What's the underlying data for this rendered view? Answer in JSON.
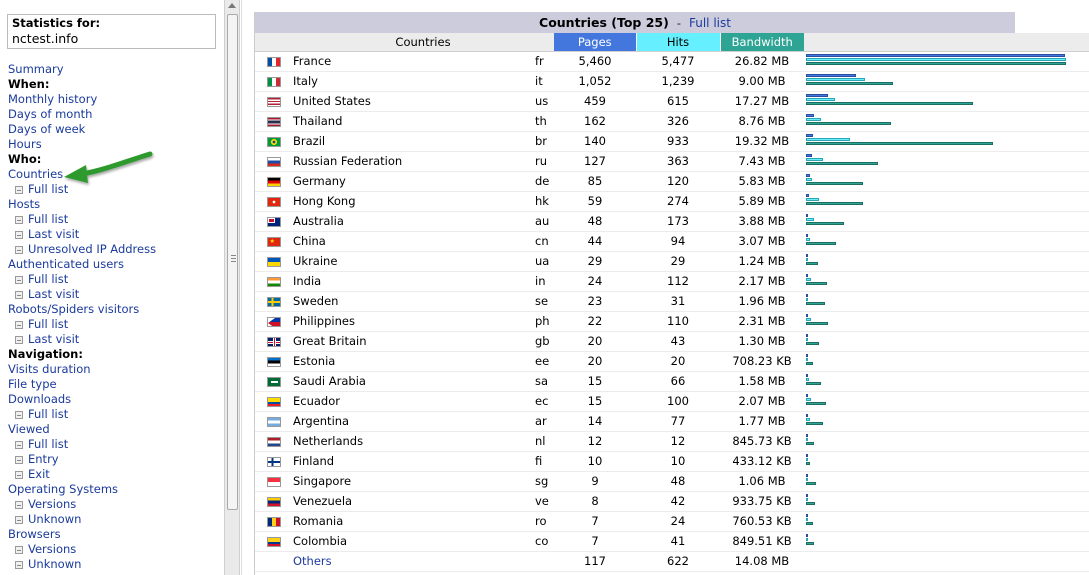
{
  "stats_box": {
    "title": "Statistics for:",
    "site": "nctest.info"
  },
  "menu": [
    {
      "type": "link",
      "label": "Summary",
      "name": "menu-summary"
    },
    {
      "type": "head",
      "label": "When:",
      "name": "menu-head-when"
    },
    {
      "type": "link",
      "label": "Monthly history",
      "name": "menu-monthly-history"
    },
    {
      "type": "link",
      "label": "Days of month",
      "name": "menu-days-of-month"
    },
    {
      "type": "link",
      "label": "Days of week",
      "name": "menu-days-of-week"
    },
    {
      "type": "link",
      "label": "Hours",
      "name": "menu-hours"
    },
    {
      "type": "head",
      "label": "Who:",
      "name": "menu-head-who"
    },
    {
      "type": "link",
      "label": "Countries",
      "name": "menu-countries"
    },
    {
      "type": "sub",
      "label": "Full list",
      "name": "menu-countries-full-list"
    },
    {
      "type": "link",
      "label": "Hosts",
      "name": "menu-hosts"
    },
    {
      "type": "sub",
      "label": "Full list",
      "name": "menu-hosts-full-list"
    },
    {
      "type": "sub",
      "label": "Last visit",
      "name": "menu-hosts-last-visit"
    },
    {
      "type": "sub",
      "label": "Unresolved IP Address",
      "name": "menu-hosts-unresolved-ip"
    },
    {
      "type": "link",
      "label": "Authenticated users",
      "name": "menu-authenticated-users"
    },
    {
      "type": "sub",
      "label": "Full list",
      "name": "menu-auth-full-list"
    },
    {
      "type": "sub",
      "label": "Last visit",
      "name": "menu-auth-last-visit"
    },
    {
      "type": "link",
      "label": "Robots/Spiders visitors",
      "name": "menu-robots"
    },
    {
      "type": "sub",
      "label": "Full list",
      "name": "menu-robots-full-list"
    },
    {
      "type": "sub",
      "label": "Last visit",
      "name": "menu-robots-last-visit"
    },
    {
      "type": "head",
      "label": "Navigation:",
      "name": "menu-head-navigation"
    },
    {
      "type": "link",
      "label": "Visits duration",
      "name": "menu-visits-duration"
    },
    {
      "type": "link",
      "label": "File type",
      "name": "menu-file-type"
    },
    {
      "type": "link",
      "label": "Downloads",
      "name": "menu-downloads"
    },
    {
      "type": "sub",
      "label": "Full list",
      "name": "menu-downloads-full-list"
    },
    {
      "type": "link",
      "label": "Viewed",
      "name": "menu-viewed"
    },
    {
      "type": "sub",
      "label": "Full list",
      "name": "menu-viewed-full-list"
    },
    {
      "type": "sub",
      "label": "Entry",
      "name": "menu-viewed-entry"
    },
    {
      "type": "sub",
      "label": "Exit",
      "name": "menu-viewed-exit"
    },
    {
      "type": "link",
      "label": "Operating Systems",
      "name": "menu-operating-systems"
    },
    {
      "type": "sub",
      "label": "Versions",
      "name": "menu-os-versions"
    },
    {
      "type": "sub",
      "label": "Unknown",
      "name": "menu-os-unknown"
    },
    {
      "type": "link",
      "label": "Browsers",
      "name": "menu-browsers"
    },
    {
      "type": "sub",
      "label": "Versions",
      "name": "menu-browsers-versions"
    },
    {
      "type": "sub",
      "label": "Unknown",
      "name": "menu-browsers-unknown"
    }
  ],
  "section": {
    "title": "Countries (Top 25)",
    "separator": "-",
    "full_list": "Full list"
  },
  "table": {
    "headers": {
      "countries": "Countries",
      "pages": "Pages",
      "hits": "Hits",
      "bandwidth": "Bandwidth"
    },
    "colors": {
      "pages": "#4477dd",
      "hits": "#66f0ff",
      "bandwidth": "#2ea495"
    },
    "rows": [
      {
        "flag": "fr",
        "name": "France",
        "code": "fr",
        "pages": "5,460",
        "hits": "5,477",
        "bw": "26.82 MB",
        "pv": 5460,
        "hv": 5477,
        "bv": 27463
      },
      {
        "flag": "it",
        "name": "Italy",
        "code": "it",
        "pages": "1,052",
        "hits": "1,239",
        "bw": "9.00 MB",
        "pv": 1052,
        "hv": 1239,
        "bv": 9216
      },
      {
        "flag": "us",
        "name": "United States",
        "code": "us",
        "pages": "459",
        "hits": "615",
        "bw": "17.27 MB",
        "pv": 459,
        "hv": 615,
        "bv": 17684
      },
      {
        "flag": "th",
        "name": "Thailand",
        "code": "th",
        "pages": "162",
        "hits": "326",
        "bw": "8.76 MB",
        "pv": 162,
        "hv": 326,
        "bv": 8970
      },
      {
        "flag": "br",
        "name": "Brazil",
        "code": "br",
        "pages": "140",
        "hits": "933",
        "bw": "19.32 MB",
        "pv": 140,
        "hv": 933,
        "bv": 19784
      },
      {
        "flag": "ru",
        "name": "Russian Federation",
        "code": "ru",
        "pages": "127",
        "hits": "363",
        "bw": "7.43 MB",
        "pv": 127,
        "hv": 363,
        "bv": 7608
      },
      {
        "flag": "de",
        "name": "Germany",
        "code": "de",
        "pages": "85",
        "hits": "120",
        "bw": "5.83 MB",
        "pv": 85,
        "hv": 120,
        "bv": 5970
      },
      {
        "flag": "hk",
        "name": "Hong Kong",
        "code": "hk",
        "pages": "59",
        "hits": "274",
        "bw": "5.89 MB",
        "pv": 59,
        "hv": 274,
        "bv": 6031
      },
      {
        "flag": "au",
        "name": "Australia",
        "code": "au",
        "pages": "48",
        "hits": "173",
        "bw": "3.88 MB",
        "pv": 48,
        "hv": 173,
        "bv": 3973
      },
      {
        "flag": "cn",
        "name": "China",
        "code": "cn",
        "pages": "44",
        "hits": "94",
        "bw": "3.07 MB",
        "pv": 44,
        "hv": 94,
        "bv": 3144
      },
      {
        "flag": "ua",
        "name": "Ukraine",
        "code": "ua",
        "pages": "29",
        "hits": "29",
        "bw": "1.24 MB",
        "pv": 29,
        "hv": 29,
        "bv": 1270
      },
      {
        "flag": "in",
        "name": "India",
        "code": "in",
        "pages": "24",
        "hits": "112",
        "bw": "2.17 MB",
        "pv": 24,
        "hv": 112,
        "bv": 2222
      },
      {
        "flag": "se",
        "name": "Sweden",
        "code": "se",
        "pages": "23",
        "hits": "31",
        "bw": "1.96 MB",
        "pv": 23,
        "hv": 31,
        "bv": 2007
      },
      {
        "flag": "ph",
        "name": "Philippines",
        "code": "ph",
        "pages": "22",
        "hits": "110",
        "bw": "2.31 MB",
        "pv": 22,
        "hv": 110,
        "bv": 2365
      },
      {
        "flag": "gb",
        "name": "Great Britain",
        "code": "gb",
        "pages": "20",
        "hits": "43",
        "bw": "1.30 MB",
        "pv": 20,
        "hv": 43,
        "bv": 1331
      },
      {
        "flag": "ee",
        "name": "Estonia",
        "code": "ee",
        "pages": "20",
        "hits": "20",
        "bw": "708.23 KB",
        "pv": 20,
        "hv": 20,
        "bv": 708
      },
      {
        "flag": "sa",
        "name": "Saudi Arabia",
        "code": "sa",
        "pages": "15",
        "hits": "66",
        "bw": "1.58 MB",
        "pv": 15,
        "hv": 66,
        "bv": 1618
      },
      {
        "flag": "ec",
        "name": "Ecuador",
        "code": "ec",
        "pages": "15",
        "hits": "100",
        "bw": "2.07 MB",
        "pv": 15,
        "hv": 100,
        "bv": 2120
      },
      {
        "flag": "ar",
        "name": "Argentina",
        "code": "ar",
        "pages": "14",
        "hits": "77",
        "bw": "1.77 MB",
        "pv": 14,
        "hv": 77,
        "bv": 1812
      },
      {
        "flag": "nl",
        "name": "Netherlands",
        "code": "nl",
        "pages": "12",
        "hits": "12",
        "bw": "845.73 KB",
        "pv": 12,
        "hv": 12,
        "bv": 846
      },
      {
        "flag": "fi",
        "name": "Finland",
        "code": "fi",
        "pages": "10",
        "hits": "10",
        "bw": "433.12 KB",
        "pv": 10,
        "hv": 10,
        "bv": 433
      },
      {
        "flag": "sg",
        "name": "Singapore",
        "code": "sg",
        "pages": "9",
        "hits": "48",
        "bw": "1.06 MB",
        "pv": 9,
        "hv": 48,
        "bv": 1085
      },
      {
        "flag": "ve",
        "name": "Venezuela",
        "code": "ve",
        "pages": "8",
        "hits": "42",
        "bw": "933.75 KB",
        "pv": 8,
        "hv": 42,
        "bv": 934
      },
      {
        "flag": "ro",
        "name": "Romania",
        "code": "ro",
        "pages": "7",
        "hits": "24",
        "bw": "760.53 KB",
        "pv": 7,
        "hv": 24,
        "bv": 761
      },
      {
        "flag": "co",
        "name": "Colombia",
        "code": "co",
        "pages": "7",
        "hits": "41",
        "bw": "849.51 KB",
        "pv": 7,
        "hv": 41,
        "bv": 850
      }
    ],
    "others": {
      "name": "Others",
      "pages": "117",
      "hits": "622",
      "bw": "14.08 MB"
    }
  }
}
